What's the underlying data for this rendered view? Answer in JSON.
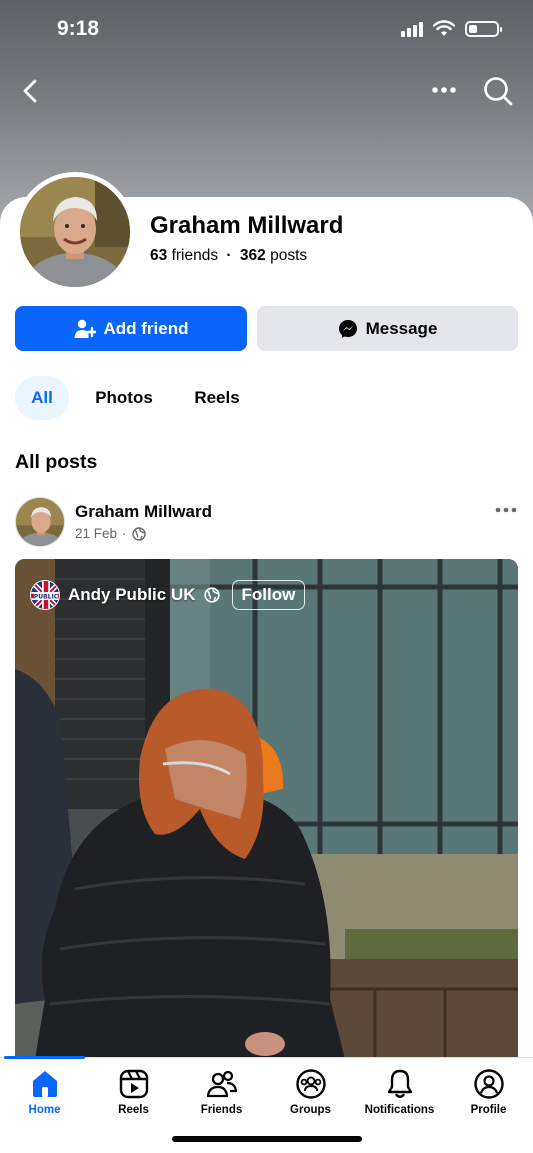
{
  "status_bar": {
    "time": "9:18"
  },
  "top_nav": {
    "back_icon": "chevron-left-icon",
    "more_icon": "more-horizontal-icon",
    "search_icon": "search-icon"
  },
  "profile": {
    "name": "Graham Millward",
    "friends_count": "63",
    "friends_label": "friends",
    "separator": "·",
    "posts_count": "362",
    "posts_label": "posts"
  },
  "actions": {
    "add_friend": "Add friend",
    "message": "Message"
  },
  "tabs": [
    {
      "label": "All",
      "active": true
    },
    {
      "label": "Photos",
      "active": false
    },
    {
      "label": "Reels",
      "active": false
    }
  ],
  "section_title": "All posts",
  "post": {
    "author": "Graham Millward",
    "date": "21 Feb",
    "meta_separator": "·",
    "audience_icon": "globe-icon",
    "video": {
      "channel_name": "Andy Public UK",
      "follow_label": "Follow",
      "logo_text": "PUBLIC"
    }
  },
  "bottom_nav": [
    {
      "label": "Home",
      "icon": "home-icon",
      "active": true
    },
    {
      "label": "Reels",
      "icon": "reels-icon",
      "active": false
    },
    {
      "label": "Friends",
      "icon": "friends-icon",
      "active": false
    },
    {
      "label": "Groups",
      "icon": "groups-icon",
      "active": false
    },
    {
      "label": "Notifications",
      "icon": "bell-icon",
      "active": false
    },
    {
      "label": "Profile",
      "icon": "profile-icon",
      "active": false
    }
  ],
  "colors": {
    "accent": "#0866ff",
    "secondary_button": "#e4e6eb",
    "muted_text": "#65676b"
  }
}
